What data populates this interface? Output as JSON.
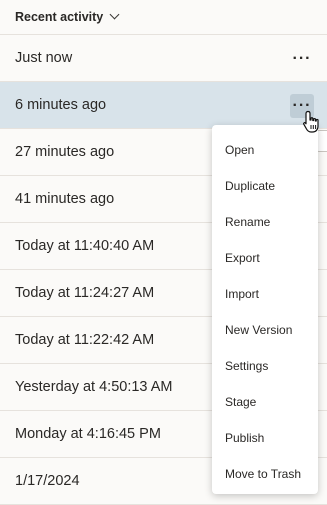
{
  "header": {
    "title": "Recent activity"
  },
  "rows": [
    {
      "label": "Just now",
      "more": "···"
    },
    {
      "label": "6 minutes ago",
      "more": "···"
    },
    {
      "label": "27 minutes ago"
    },
    {
      "label": "41 minutes ago"
    },
    {
      "label": "Today at 11:40:40 AM"
    },
    {
      "label": "Today at 11:24:27 AM"
    },
    {
      "label": "Today at 11:22:42 AM"
    },
    {
      "label": "Yesterday at 4:50:13 AM"
    },
    {
      "label": "Monday at 4:16:45 PM"
    },
    {
      "label": "1/17/2024"
    }
  ],
  "menu": {
    "items": [
      "Open",
      "Duplicate",
      "Rename",
      "Export",
      "Import",
      "New Version",
      "Settings",
      "Stage",
      "Publish",
      "Move to Trash"
    ]
  },
  "colors": {
    "selected_row": "#d8e3ea",
    "background": "#fbfaf8"
  }
}
